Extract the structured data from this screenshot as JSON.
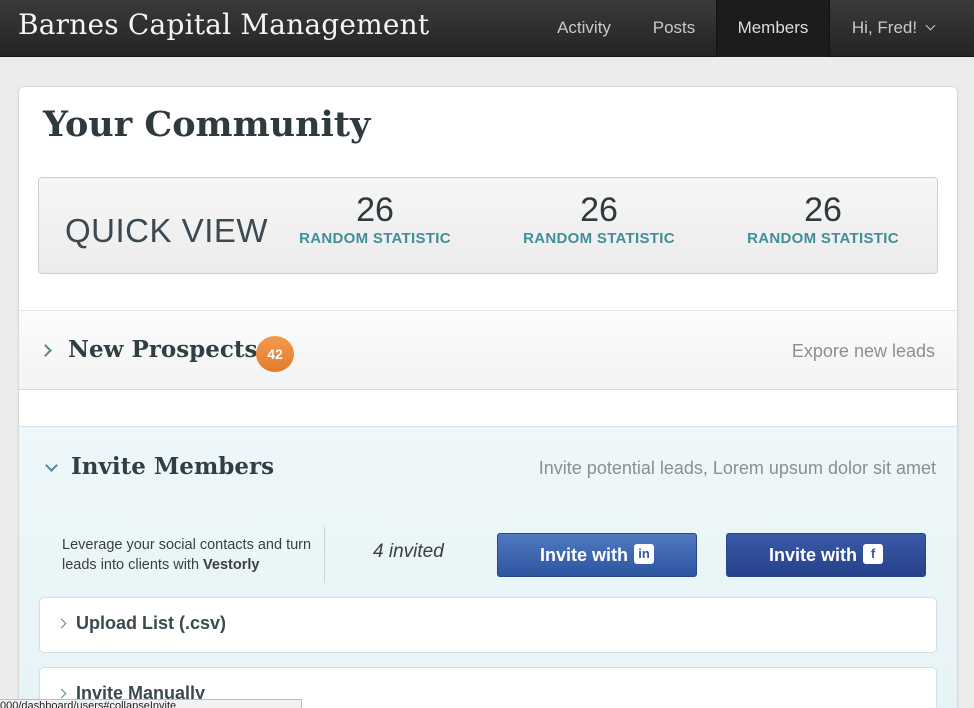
{
  "navbar": {
    "brand": "Barnes Capital Management",
    "items": [
      {
        "label": "Activity"
      },
      {
        "label": "Posts"
      },
      {
        "label": "Members"
      },
      {
        "label": "Hi, Fred!"
      }
    ]
  },
  "page": {
    "title": "Your Community"
  },
  "quickview": {
    "label": "QUICK VIEW",
    "stats": [
      {
        "value": "26",
        "label": "RANDOM STATISTIC"
      },
      {
        "value": "26",
        "label": "RANDOM STATISTIC"
      },
      {
        "value": "26",
        "label": "RANDOM STATISTIC"
      }
    ]
  },
  "prospects": {
    "title": "New Prospects",
    "count": "42",
    "hint": "Expore new leads"
  },
  "invite": {
    "title": "Invite Members",
    "hint": "Invite potential leads, Lorem upsum dolor sit amet",
    "lev_text": "Leverage your social contacts and turn leads into clients with",
    "lev_brand": "Vestorly",
    "invited": "4 invited",
    "btn_linkedin": "Invite with",
    "btn_facebook": "Invite with",
    "linkedin_glyph": "in",
    "facebook_glyph": "f",
    "upload_title": "Upload List (.csv)",
    "manual_title": "Invite Manually"
  },
  "statusbar": {
    "url": "000/dashboard/users#collapseInvite"
  }
}
